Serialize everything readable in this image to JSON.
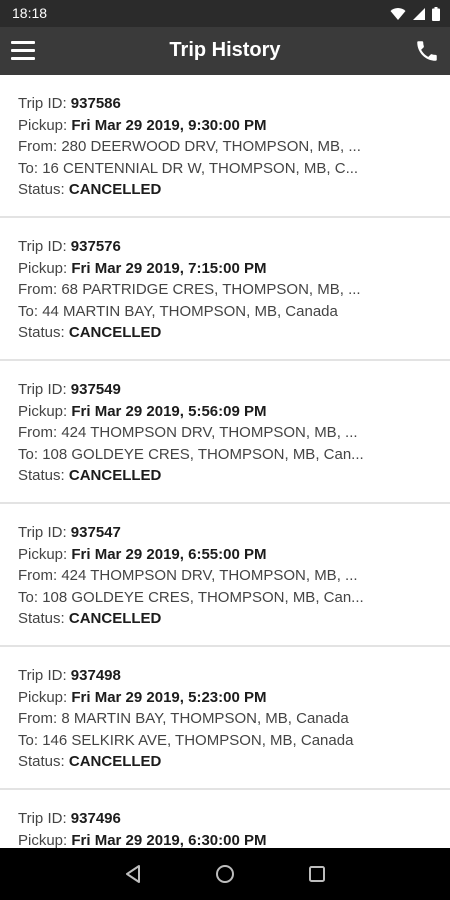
{
  "status_bar": {
    "time": "18:18",
    "icons": [
      "wifi-icon",
      "signal-icon",
      "battery-icon"
    ]
  },
  "header": {
    "title": "Trip History",
    "menu_icon": "hamburger-menu-icon",
    "phone_icon": "phone-icon"
  },
  "labels": {
    "trip_id": "Trip ID:",
    "pickup": "Pickup:",
    "from": "From:",
    "to": "To:",
    "status": "Status:"
  },
  "trips": [
    {
      "id": "937586",
      "pickup": "Fri Mar 29 2019, 9:30:00 PM",
      "from": "280 DEERWOOD DRV, THOMPSON, MB, ...",
      "to": "16 CENTENNIAL DR W, THOMPSON, MB, C...",
      "status": "CANCELLED"
    },
    {
      "id": "937576",
      "pickup": "Fri Mar 29 2019, 7:15:00 PM",
      "from": "68 PARTRIDGE CRES, THOMPSON, MB, ...",
      "to": "44 MARTIN BAY, THOMPSON, MB, Canada",
      "status": "CANCELLED"
    },
    {
      "id": "937549",
      "pickup": "Fri Mar 29 2019, 5:56:09 PM",
      "from": "424 THOMPSON DRV, THOMPSON, MB, ...",
      "to": "108 GOLDEYE CRES, THOMPSON, MB, Can...",
      "status": "CANCELLED"
    },
    {
      "id": "937547",
      "pickup": "Fri Mar 29 2019, 6:55:00 PM",
      "from": "424 THOMPSON DRV, THOMPSON, MB, ...",
      "to": "108 GOLDEYE CRES, THOMPSON, MB, Can...",
      "status": "CANCELLED"
    },
    {
      "id": "937498",
      "pickup": "Fri Mar 29 2019, 5:23:00 PM",
      "from": "8 MARTIN BAY, THOMPSON, MB, Canada",
      "to": "146 SELKIRK AVE, THOMPSON, MB, Canada",
      "status": "CANCELLED"
    },
    {
      "id": "937496",
      "pickup": "Fri Mar 29 2019, 6:30:00 PM",
      "from": "",
      "to": "",
      "status": ""
    }
  ],
  "nav_bar": {
    "buttons": [
      "back-icon",
      "home-icon",
      "recents-icon"
    ]
  },
  "colors": {
    "status_bar": "#2b2b2b",
    "app_bar": "#3a3a3a",
    "divider": "#e3e3e3",
    "text": "#444444",
    "nav_bar": "#000000"
  }
}
